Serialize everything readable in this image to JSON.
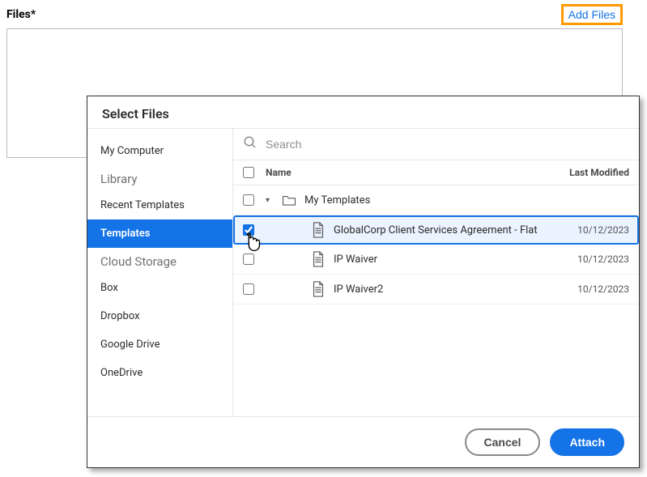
{
  "files": {
    "label": "Files*",
    "add_button": "Add Files"
  },
  "modal": {
    "title": "Select Files",
    "search_placeholder": "Search",
    "sidebar": {
      "groups": [
        {
          "items": [
            {
              "label": "My Computer"
            }
          ]
        },
        {
          "header": "Library",
          "items": [
            {
              "label": "Recent Templates"
            },
            {
              "label": "Templates",
              "active": true
            }
          ]
        },
        {
          "header": "Cloud Storage",
          "items": [
            {
              "label": "Box"
            },
            {
              "label": "Dropbox"
            },
            {
              "label": "Google Drive"
            },
            {
              "label": "OneDrive"
            }
          ]
        }
      ]
    },
    "table": {
      "col_name": "Name",
      "col_modified": "Last Modified",
      "folder": {
        "name": "My Templates"
      },
      "files": [
        {
          "name": "GlobalCorp Client Services Agreement - Flat",
          "modified": "10/12/2023",
          "selected": true
        },
        {
          "name": "IP Waiver",
          "modified": "10/12/2023",
          "selected": false
        },
        {
          "name": "IP Waiver2",
          "modified": "10/12/2023",
          "selected": false
        }
      ]
    },
    "footer": {
      "cancel": "Cancel",
      "attach": "Attach"
    }
  }
}
